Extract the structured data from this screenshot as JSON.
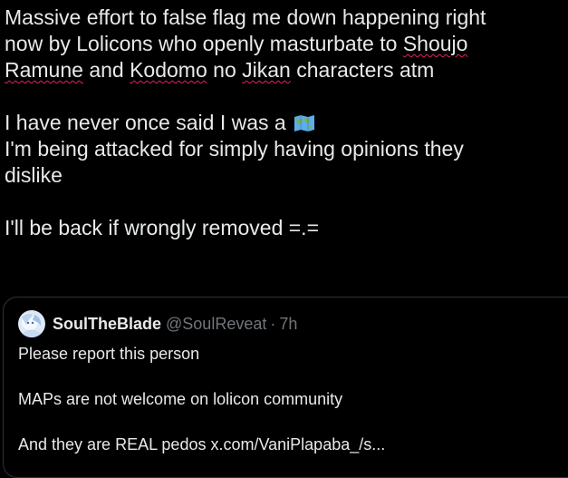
{
  "post": {
    "line1": "Massive effort to false flag me down happening right",
    "line2_a": "now by Lolicons who openly masturbate to ",
    "line2_b": "Shoujo",
    "line3_a": "Ramune",
    "line3_b": " and ",
    "line3_c": "Kodomo",
    "line3_d": " no ",
    "line3_e": "Jikan",
    "line3_f": " characters atm",
    "line4": "I have never once said I was a",
    "line4_emoji": "world-map-icon",
    "line5": "I'm being attacked for simply having opinions they",
    "line6": "dislike",
    "line7": "I'll be back if wrongly removed =.="
  },
  "quote": {
    "name": "SoulTheBlade",
    "handle": "@SoulReveat",
    "separator": "·",
    "time": "7h",
    "line1": "Please report this person",
    "line2": "MAPs are not welcome on lolicon community",
    "line3": "And they are REAL pedos x.com/VaniPlapaba_/s..."
  },
  "colors": {
    "background": "#000000",
    "text": "#e7e9ea",
    "muted": "#71767b",
    "border": "#2f3336",
    "spellcheck": "#e0245e"
  }
}
